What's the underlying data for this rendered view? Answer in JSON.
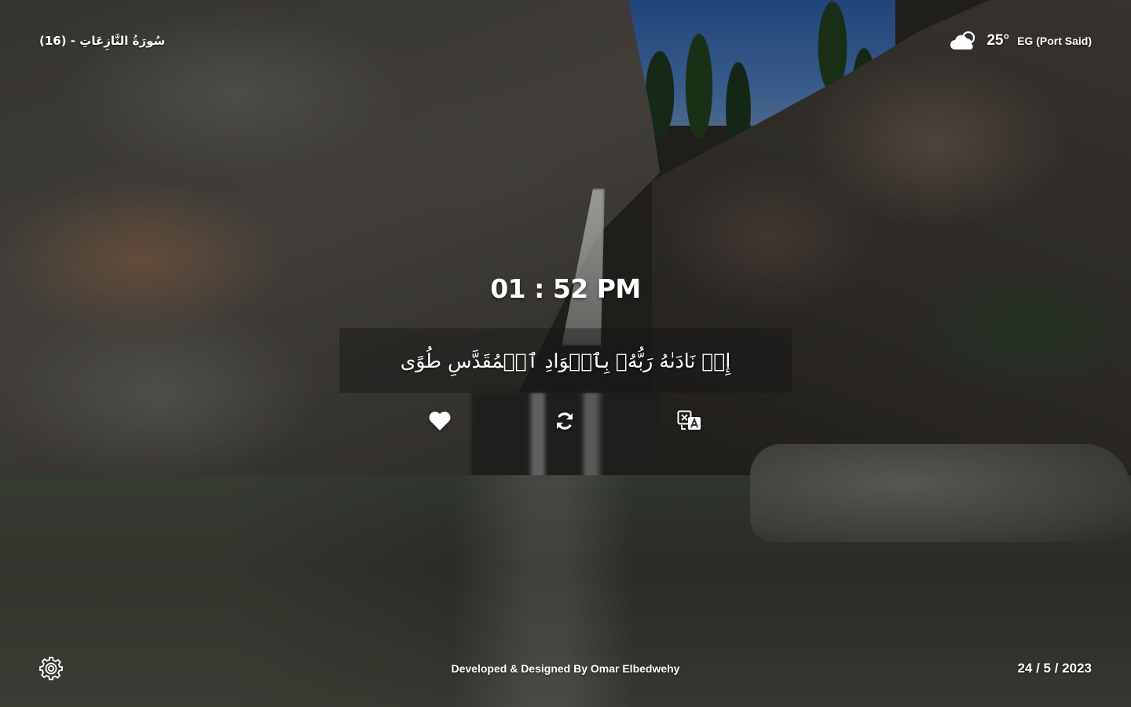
{
  "surah": {
    "title": "سُورَةُ النَّازِعَاتِ - (16)"
  },
  "weather": {
    "icon": "cloud-sun-icon",
    "temperature": "25°",
    "location": "EG (Port Said)"
  },
  "clock": {
    "time": "01 : 52 PM"
  },
  "verse": {
    "text": "إِذۡ نَادَىٰهُ رَبُّهُۥ بِٱلۡوَادِ ٱلۡمُقَدَّسِ طُوًى"
  },
  "actions": [
    {
      "icon": "heart-icon",
      "purpose": "favorite"
    },
    {
      "icon": "refresh-icon",
      "purpose": "new verse"
    },
    {
      "icon": "translate-icon",
      "purpose": "translate"
    }
  ],
  "footer": {
    "settings_icon": "gear-icon",
    "credits": "Developed & Designed By Omar Elbedwehy",
    "date": "24 / 5 / 2023"
  },
  "theme": {
    "text_color": "#ffffff",
    "overlay": "#141414"
  }
}
